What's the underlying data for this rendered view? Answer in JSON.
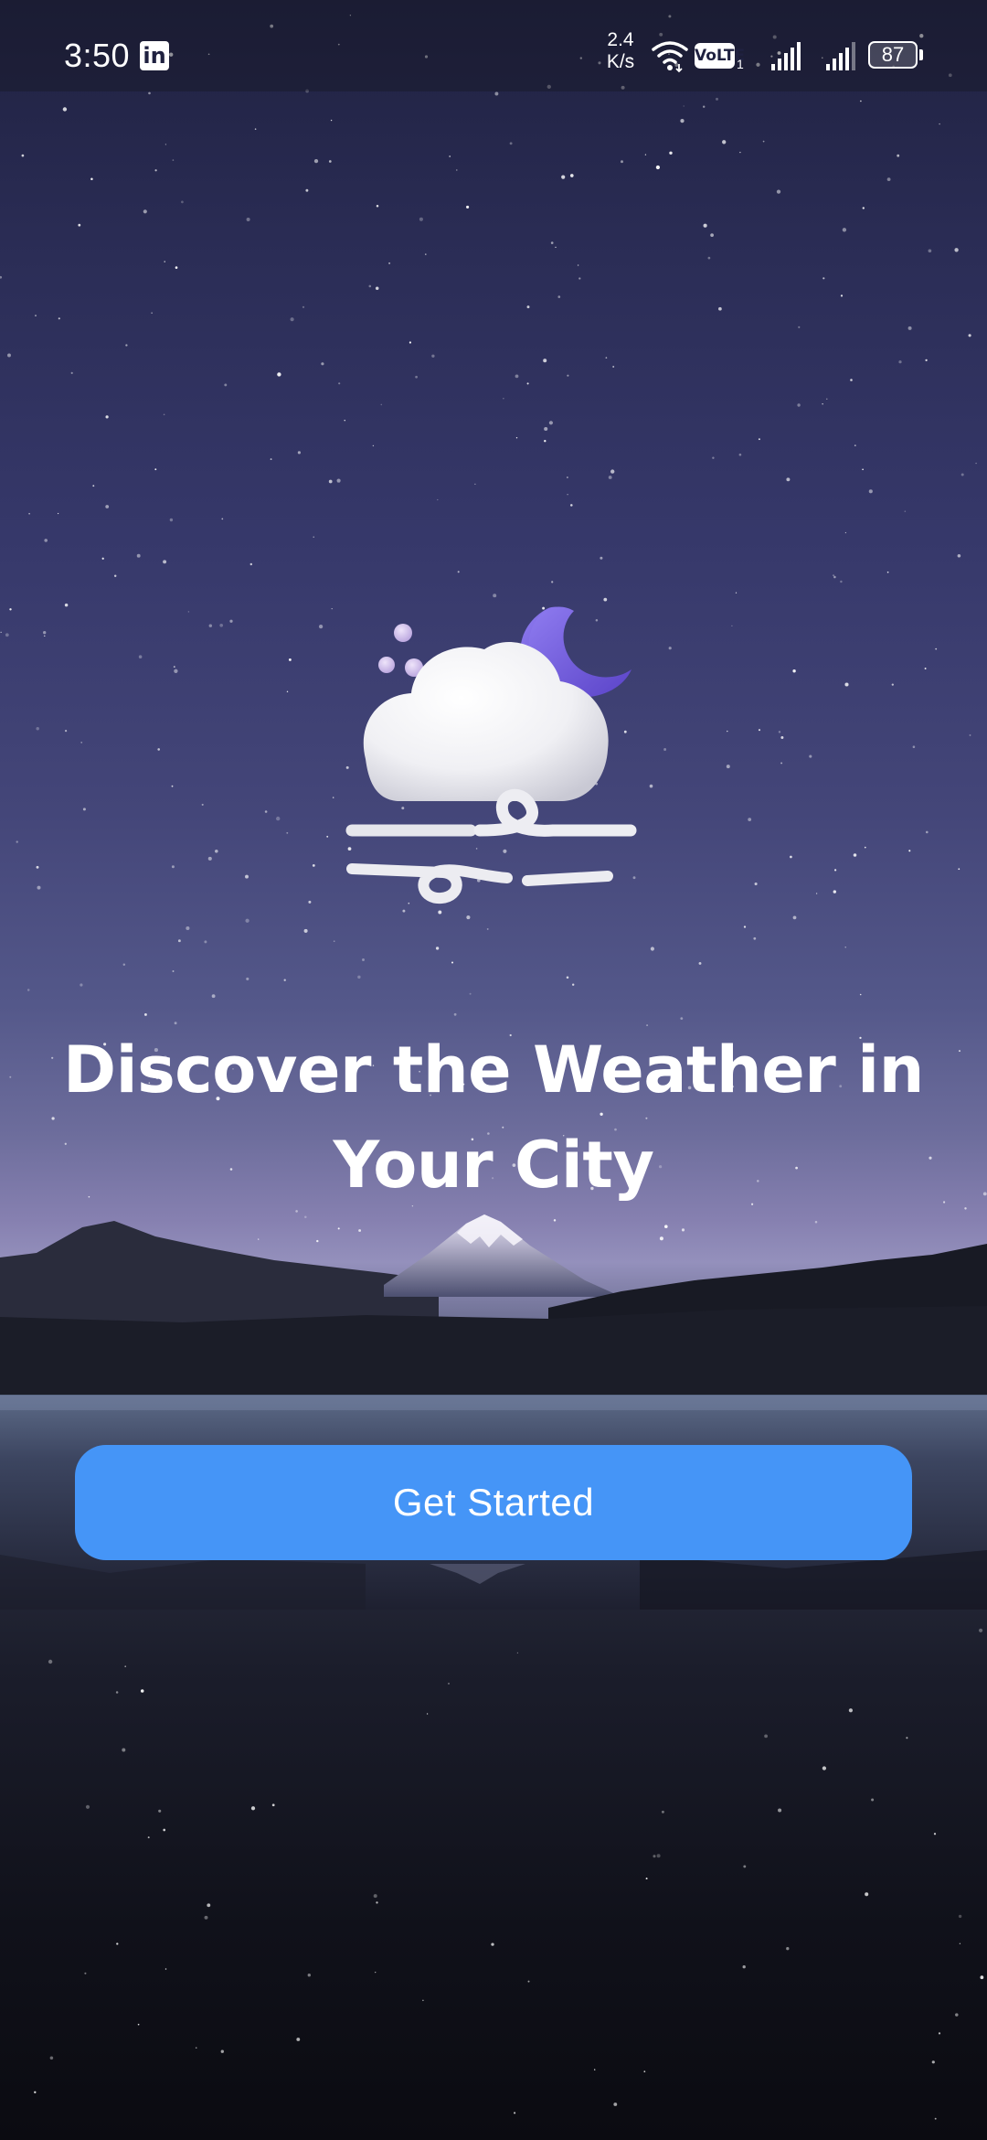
{
  "status_bar": {
    "time": "3:50",
    "notification_icon": "linkedin-icon",
    "notification_icon_text": "in",
    "network_speed_value": "2.4",
    "network_speed_unit": "K/s",
    "wifi_icon": "wifi-icon",
    "volte_label": "VoLTE",
    "volte_sim": "1",
    "signal_icons": [
      "signal-icon",
      "signal-icon"
    ],
    "battery_level": "87"
  },
  "illustration": {
    "icon": "cloudy-night-wind-icon",
    "colors": {
      "cloud": "#f2f2f4",
      "moon": "#7b66e0",
      "dots": "#c9b7e6"
    }
  },
  "onboarding": {
    "headline": "Discover the Weather in Your City",
    "cta_label": "Get Started"
  },
  "theme": {
    "button_color": "#4595f7",
    "text_color": "#ffffff",
    "sky_top": "#1f2140",
    "sky_horizon": "#9490bc"
  }
}
